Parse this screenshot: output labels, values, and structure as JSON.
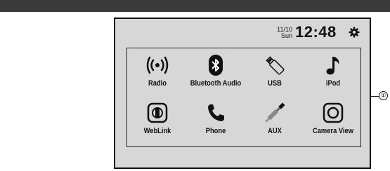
{
  "status": {
    "date_top": "11/10",
    "date_bottom": "Sun",
    "time": "12:48"
  },
  "tiles": [
    {
      "label": "Radio",
      "icon": "radio-waves-icon"
    },
    {
      "label": "Bluetooth Audio",
      "icon": "bluetooth-icon"
    },
    {
      "label": "USB",
      "icon": "usb-stick-icon"
    },
    {
      "label": "iPod",
      "icon": "music-note-icon"
    },
    {
      "label": "WebLink",
      "icon": "weblink-icon"
    },
    {
      "label": "Phone",
      "icon": "phone-handset-icon"
    },
    {
      "label": "AUX",
      "icon": "aux-plug-icon"
    },
    {
      "label": "Camera View",
      "icon": "camera-view-icon"
    }
  ],
  "callout": {
    "label": "①"
  }
}
